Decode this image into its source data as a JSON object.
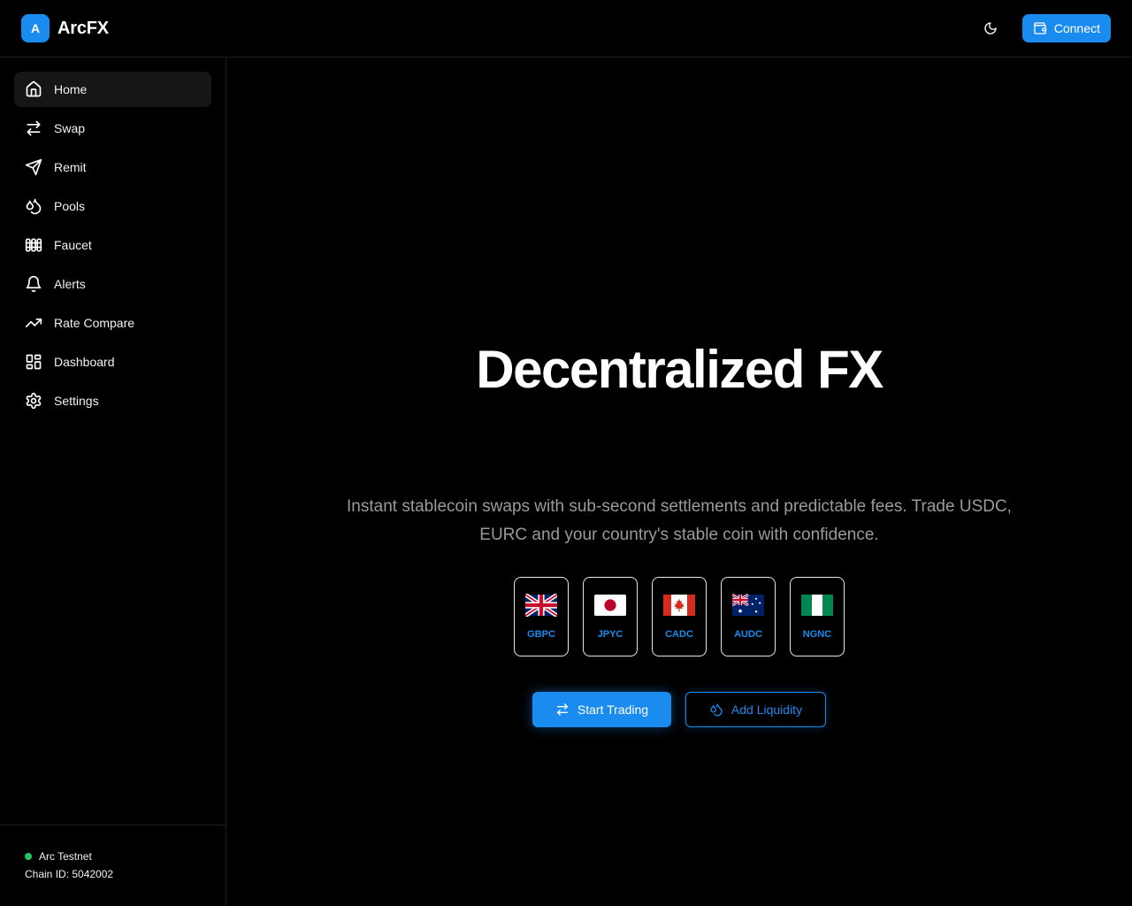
{
  "header": {
    "logo_letter": "A",
    "brand": "ArcFX",
    "theme_icon": "moon-icon",
    "connect_label": "Connect"
  },
  "sidebar": {
    "items": [
      {
        "label": "Home",
        "icon": "home-icon",
        "active": true
      },
      {
        "label": "Swap",
        "icon": "swap-arrows-icon"
      },
      {
        "label": "Remit",
        "icon": "send-icon"
      },
      {
        "label": "Pools",
        "icon": "droplets-icon"
      },
      {
        "label": "Faucet",
        "icon": "faucet-icon"
      },
      {
        "label": "Alerts",
        "icon": "bell-icon"
      },
      {
        "label": "Rate Compare",
        "icon": "trending-up-icon"
      },
      {
        "label": "Dashboard",
        "icon": "dashboard-icon"
      },
      {
        "label": "Settings",
        "icon": "gear-icon"
      }
    ],
    "network": {
      "name": "Arc Testnet",
      "chain_id": "Chain ID: 5042002",
      "status_color": "#22c55e"
    }
  },
  "hero": {
    "title": "Decentralized FX",
    "subtitle": "Instant stablecoin swaps with sub-second settlements and predictable fees. Trade USDC, EURC and your country's stable coin with confidence.",
    "coins": [
      {
        "label": "GBPC",
        "flag": "uk-flag-icon"
      },
      {
        "label": "JPYC",
        "flag": "japan-flag-icon"
      },
      {
        "label": "CADC",
        "flag": "canada-flag-icon"
      },
      {
        "label": "AUDC",
        "flag": "australia-flag-icon"
      },
      {
        "label": "NGNC",
        "flag": "nigeria-flag-icon"
      }
    ],
    "primary_action": "Start Trading",
    "secondary_action": "Add Liquidity"
  },
  "colors": {
    "accent": "#1a8cf0",
    "background": "#000000",
    "muted_text": "#9a9a9a"
  }
}
